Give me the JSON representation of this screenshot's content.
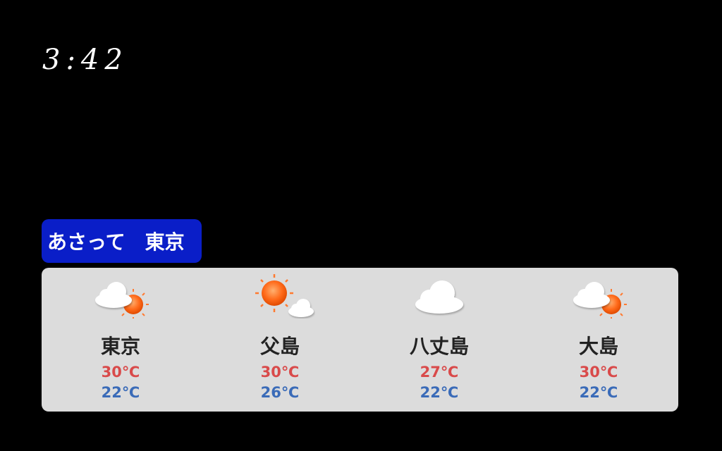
{
  "clock": "3:42",
  "header": {
    "label": "あさって　東京"
  },
  "colors": {
    "header_bg": "#0a1ec8",
    "panel_bg": "#dcdcdc",
    "high_temp": "#d94a4a",
    "low_temp": "#3a6bb8",
    "sun": "#ff6a1a"
  },
  "forecast": [
    {
      "city": "東京",
      "icon": "cloudy-then-sunny-icon",
      "high": "30℃",
      "low": "22℃"
    },
    {
      "city": "父島",
      "icon": "sunny-then-cloudy-icon",
      "high": "30℃",
      "low": "26℃"
    },
    {
      "city": "八丈島",
      "icon": "cloudy-icon",
      "high": "27℃",
      "low": "22℃"
    },
    {
      "city": "大島",
      "icon": "cloudy-then-sunny-icon",
      "high": "30℃",
      "low": "22℃"
    }
  ]
}
